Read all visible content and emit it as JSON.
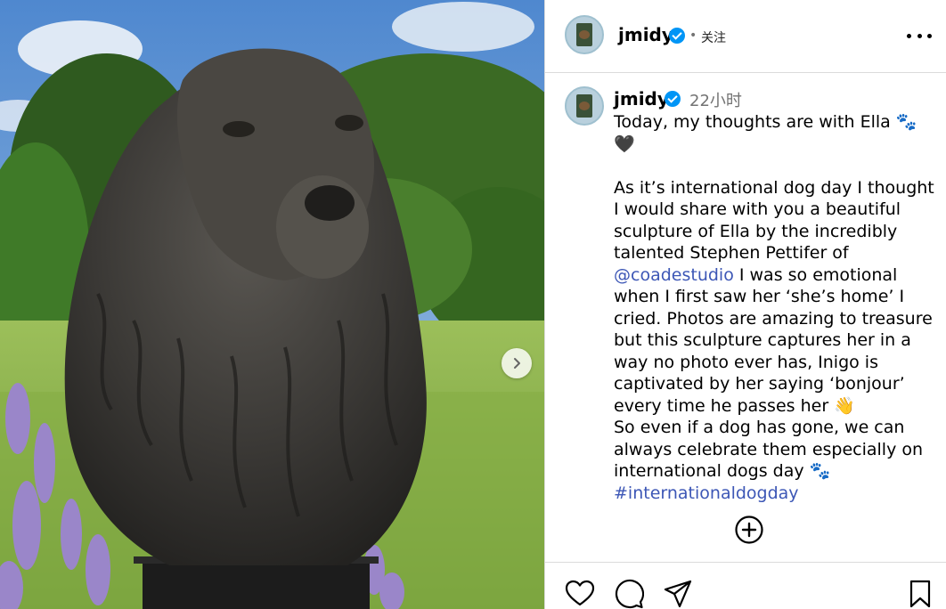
{
  "post": {
    "author": {
      "username": "jmidy",
      "verified": true
    },
    "header": {
      "separator": "•",
      "follow_label": "关注",
      "more_icon": "more-horizontal-icon"
    },
    "caption": {
      "time": "22小时",
      "line1": "Today, my thoughts are with Ella 🐾 🖤",
      "para2_a": "As it’s international dog day I thought I would share with you a beautiful sculpture of Ella by the incredibly talented Stephen Pettifer of ",
      "mention": "@coadestudio",
      "para2_b": " I was so emotional when I first saw her ‘she’s home’ I cried. Photos are amazing to treasure but this sculpture captures her in a way no photo ever has, Inigo is captivated by her saying ‘bonjour’ every time he passes her 👋",
      "para3": "So even if a dog has gone, we can always celebrate them especially on international dogs day 🐾",
      "hashtag": "#internationaldogday"
    },
    "media": {
      "description_icon": "dog-sculpture-photo",
      "next_icon": "chevron-right-icon"
    },
    "actions": {
      "like_icon": "heart-icon",
      "comment_icon": "comment-icon",
      "share_icon": "send-icon",
      "save_icon": "bookmark-icon",
      "add_comment_icon": "plus-circle-icon"
    },
    "colors": {
      "link": "#3d57b6",
      "verified": "#0095f6",
      "muted": "#737373",
      "divider": "#dbdbdb"
    }
  }
}
